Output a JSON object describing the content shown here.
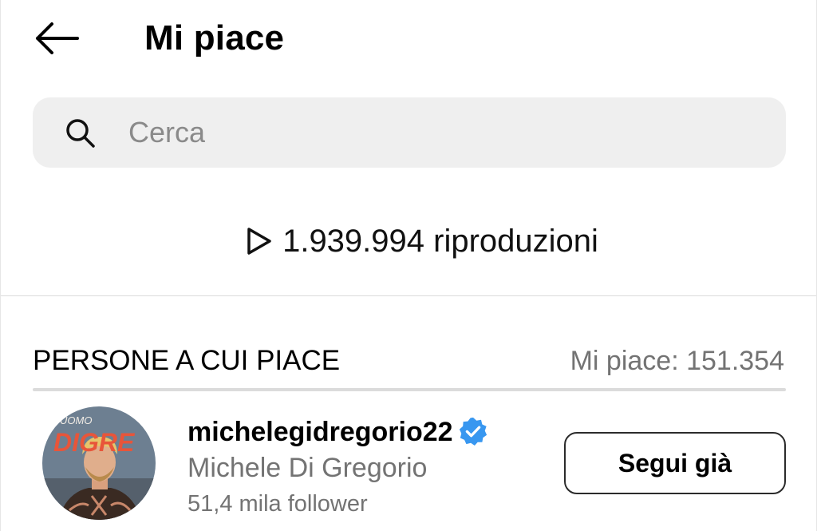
{
  "header": {
    "title": "Mi piace",
    "back_icon": "arrow-left-icon"
  },
  "search": {
    "placeholder": "Cerca",
    "value": "",
    "icon": "search-icon"
  },
  "plays": {
    "icon": "play-icon",
    "text": "1.939.994 riproduzioni"
  },
  "likers_section": {
    "title": "PERSONE A CUI PIACE",
    "likes_count": "Mi piace: 151.354"
  },
  "users": [
    {
      "username": "michelegidregorio22",
      "full_name": "Michele Di Gregorio",
      "followers": "51,4 mila follower",
      "verified": true,
      "verified_color": "#3897f0",
      "follow_button": "Segui già",
      "avatar_logo_top": "UOMO",
      "avatar_logo_main": "DIGRE"
    }
  ],
  "colors": {
    "search_bg": "#efefef",
    "secondary_text": "#737373",
    "divider": "#dbdbdb",
    "avatar_logo": "#e8553a"
  }
}
